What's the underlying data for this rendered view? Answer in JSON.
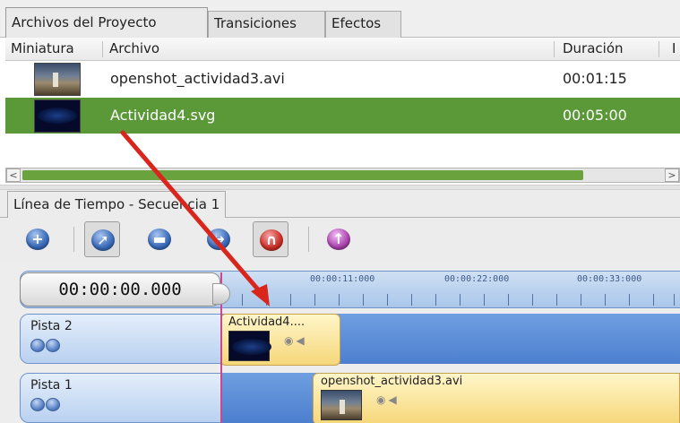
{
  "project_panel": {
    "tabs": [
      "Archivos del Proyecto",
      "Transiciones",
      "Efectos"
    ],
    "columns": {
      "thumbnail": "Miniatura",
      "file": "Archivo",
      "duration": "Duración",
      "extra": "I"
    },
    "files": [
      {
        "name": "openshot_actividad3.avi",
        "duration": "00:01:15",
        "selected": false
      },
      {
        "name": "Actividad4.svg",
        "duration": "00:05:00",
        "selected": true
      }
    ],
    "scroll": {
      "left_arrow": "<",
      "right_arrow": ">"
    }
  },
  "timeline": {
    "tab": "Línea de Tiempo - Secuencia 1",
    "toolbar_icons": [
      "add-track-icon",
      "select-pointer-icon",
      "razor-icon",
      "resize-icon",
      "snap-magnet-icon",
      "marker-icon"
    ],
    "timecode": "00:00:00.000",
    "ruler_labels": [
      "00:00:11:000",
      "00:00:22:000",
      "00:00:33:000"
    ],
    "tracks": [
      {
        "name": "Pista 2",
        "clip": "Actividad4...."
      },
      {
        "name": "Pista 1",
        "clip": "openshot_actividad3.avi"
      }
    ]
  },
  "colors": {
    "selection": "#5b9838",
    "track": "#4c7fcf",
    "clip": "#f6d77a",
    "annotation_arrow": "#d9261c"
  }
}
